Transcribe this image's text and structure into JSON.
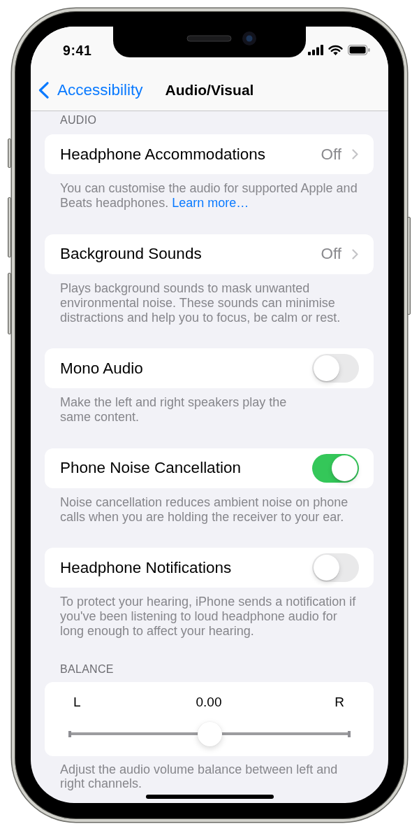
{
  "status_bar": {
    "time": "9:41"
  },
  "nav_bar": {
    "back_label": "Accessibility",
    "title": "Audio/Visual"
  },
  "sections": [
    {
      "header": "AUDIO",
      "groups": [
        {
          "kind": "disclosure",
          "label": "Headphone Accommodations",
          "value": "Off",
          "footer": "You can customise the audio for supported Apple and\nBeats headphones.",
          "footer_link": "Learn more…"
        },
        {
          "kind": "disclosure",
          "label": "Background Sounds",
          "value": "Off",
          "footer": "Plays background sounds to mask unwanted\nenvironmental noise. These sounds can minimise\ndistractions and help you to focus, be calm or rest."
        },
        {
          "kind": "toggle",
          "label": "Mono Audio",
          "on": false,
          "footer": "Make the left and right speakers play the\nsame content."
        },
        {
          "kind": "toggle",
          "label": "Phone Noise Cancellation",
          "on": true,
          "footer": "Noise cancellation reduces ambient noise on phone\ncalls when you are holding the receiver to your ear."
        },
        {
          "kind": "toggle",
          "label": "Headphone Notifications",
          "on": false,
          "footer": "To protect your hearing, iPhone sends a notification if\nyou've been listening to loud headphone audio for\nlong enough to affect your hearing."
        }
      ]
    },
    {
      "header": "BALANCE",
      "groups": [
        {
          "kind": "slider",
          "left_label": "L",
          "right_label": "R",
          "reading": "0.00",
          "level": 0.5,
          "footer": "Adjust the audio volume balance between left and\nright channels."
        }
      ]
    }
  ]
}
